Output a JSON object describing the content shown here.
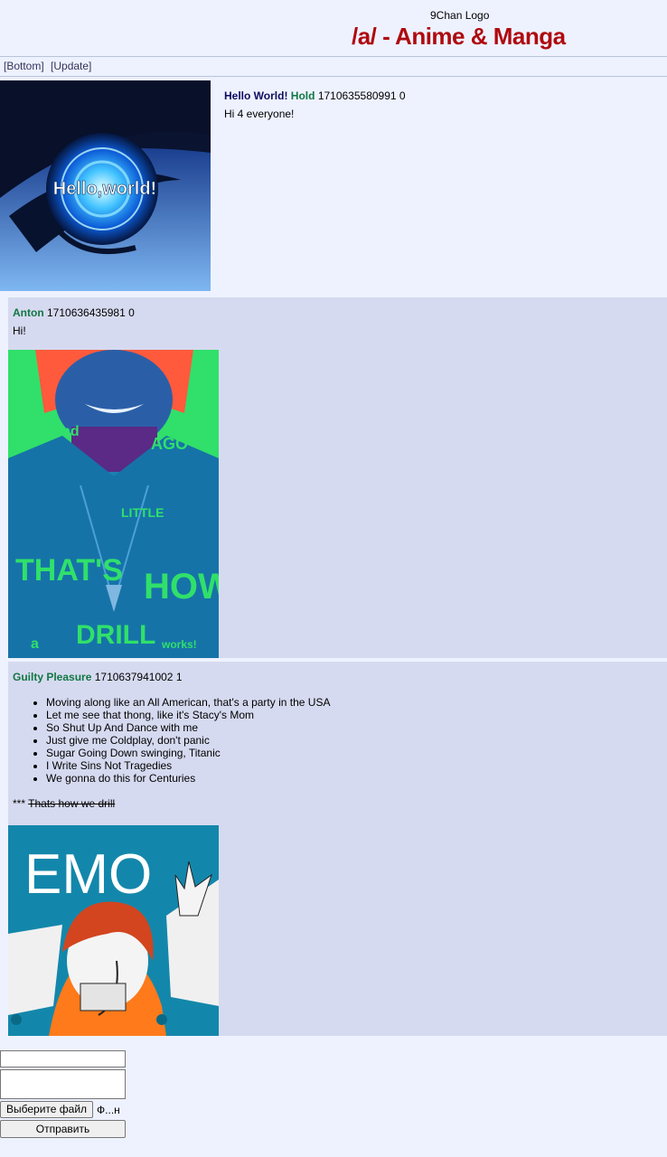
{
  "header": {
    "logo_alt": "9Chan Logo",
    "board_title": "/a/ - Anime & Manga"
  },
  "nav": {
    "bottom": "[Bottom]",
    "update": "[Update]"
  },
  "op": {
    "subject": "Hello World!",
    "name": "Hold",
    "post_id": "1710635580991",
    "replies": "0",
    "message": "Hi 4 everyone!",
    "image_text": "Hello,world!"
  },
  "replies": [
    {
      "name": "Anton",
      "post_id": "1710636435981",
      "replies": "0",
      "message": "Hi!"
    },
    {
      "name": "Guilty Pleasure",
      "post_id": "1710637941002",
      "replies": "1",
      "list": [
        "Moving along like an All American, that's a party in the USA",
        "Let me see that thong, like it's Stacy's Mom",
        "So Shut Up And Dance with me",
        "Just give me Coldplay, don't panic",
        "Sugar Going Down swinging, Titanic",
        "I Write Sins Not Tragedies",
        "We gonna do this for Centuries"
      ],
      "prefix": "***",
      "strike_text": "Thats how we drill",
      "image_text": "EMO"
    }
  ],
  "form": {
    "name_value": "",
    "message_value": "",
    "file_button": "Выберите файл",
    "file_name": "Ф...н",
    "submit_label": "Отправить"
  }
}
